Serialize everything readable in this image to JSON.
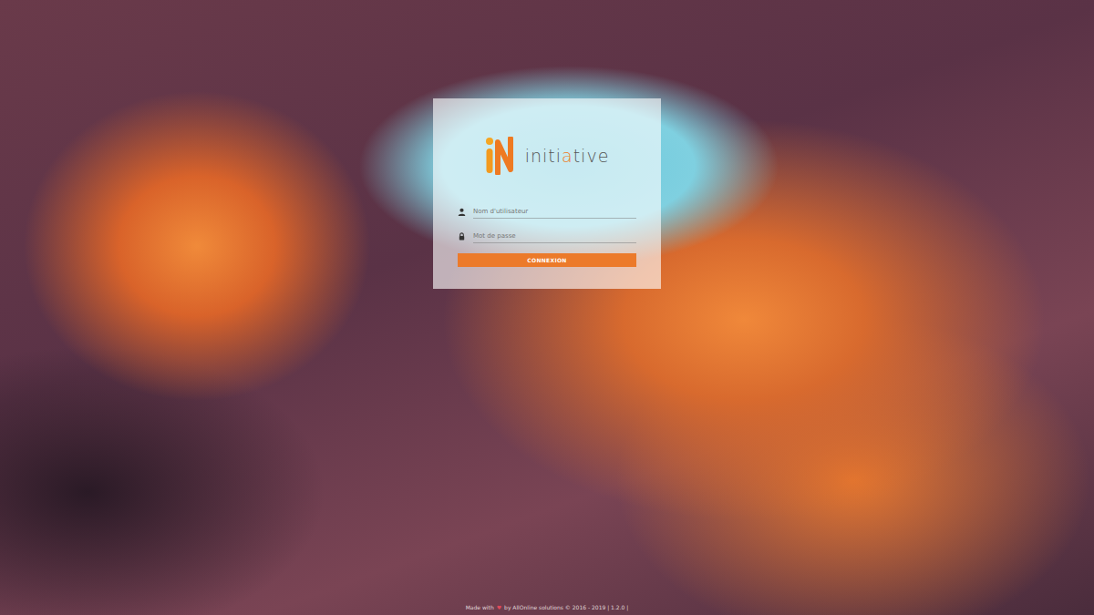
{
  "logo": {
    "parts": [
      {
        "text": "initi",
        "accent": false
      },
      {
        "text": "a",
        "accent": true
      },
      {
        "text": "tive",
        "accent": false
      }
    ]
  },
  "fields": [
    {
      "placeholder": "Nom d'utilisateur",
      "kind": "text"
    },
    {
      "placeholder": "Mot de passe",
      "kind": "password"
    }
  ],
  "button": {
    "label": "CONNEXION"
  },
  "footer": {
    "before": "Made with",
    "heart": "♥",
    "after": "by AllOnline solutions © 2016 - 2019 | 1.2.0 |"
  }
}
